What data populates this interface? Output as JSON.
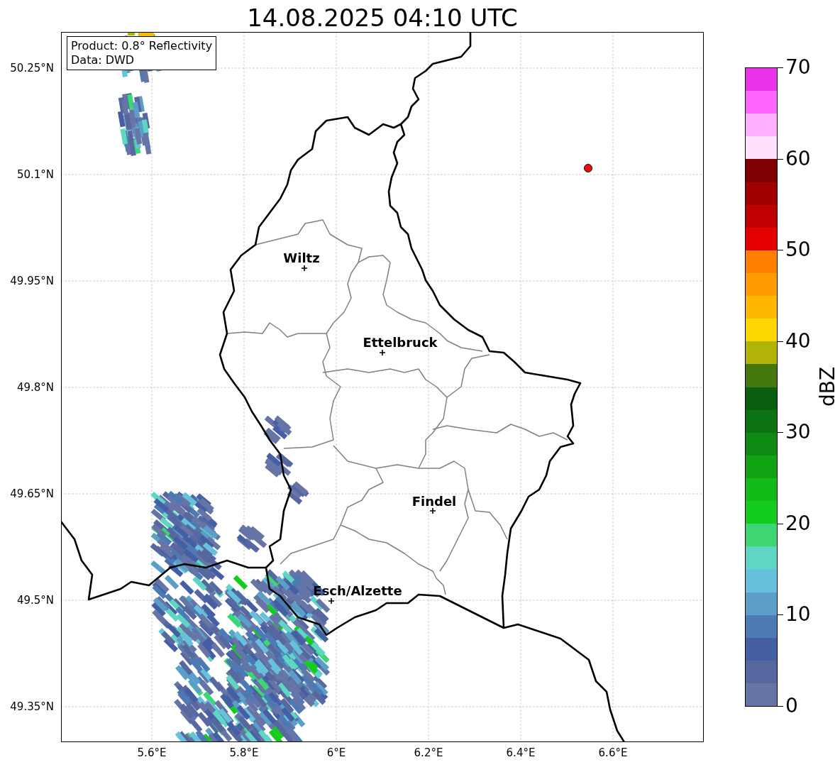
{
  "title": "14.08.2025 04:10 UTC",
  "legend": {
    "lines": [
      "Product: 0.8° Reflectivity",
      "Data: DWD"
    ]
  },
  "map": {
    "x_labels": [
      "5.6°E",
      "5.8°E",
      "6°E",
      "6.2°E",
      "6.4°E",
      "6.6°E"
    ],
    "y_labels": [
      "50.25°N",
      "50.1°N",
      "49.95°N",
      "49.8°N",
      "49.65°N",
      "49.5°N",
      "49.35°N"
    ],
    "cities": [
      {
        "name": "Wiltz"
      },
      {
        "name": "Ettelbruck"
      },
      {
        "name": "Findel"
      },
      {
        "name": "Esch/Alzette"
      }
    ]
  },
  "colorbar": {
    "label": "dBZ",
    "ticks": [
      "70",
      "60",
      "50",
      "40",
      "30",
      "20",
      "10",
      "0"
    ],
    "bands": [
      {
        "color": "#e933e9"
      },
      {
        "color": "#ff66ff"
      },
      {
        "color": "#ffb0ff"
      },
      {
        "color": "#ffe0ff"
      },
      {
        "color": "#7f0000"
      },
      {
        "color": "#a00000"
      },
      {
        "color": "#c00000"
      },
      {
        "color": "#e50000"
      },
      {
        "color": "#ff7f00"
      },
      {
        "color": "#ff9c00"
      },
      {
        "color": "#ffb800"
      },
      {
        "color": "#ffd700"
      },
      {
        "color": "#b2b308"
      },
      {
        "color": "#44780c"
      },
      {
        "color": "#0a5e10"
      },
      {
        "color": "#0c7212"
      },
      {
        "color": "#0e8a12"
      },
      {
        "color": "#11a313"
      },
      {
        "color": "#12bb17"
      },
      {
        "color": "#14cc1e"
      },
      {
        "color": "#3ed673"
      },
      {
        "color": "#5fd6c3"
      },
      {
        "color": "#66c2dc"
      },
      {
        "color": "#5b9ec8"
      },
      {
        "color": "#4b7ab4"
      },
      {
        "color": "#455fa4"
      },
      {
        "color": "#5767a0"
      },
      {
        "color": "#6675a6"
      }
    ]
  }
}
